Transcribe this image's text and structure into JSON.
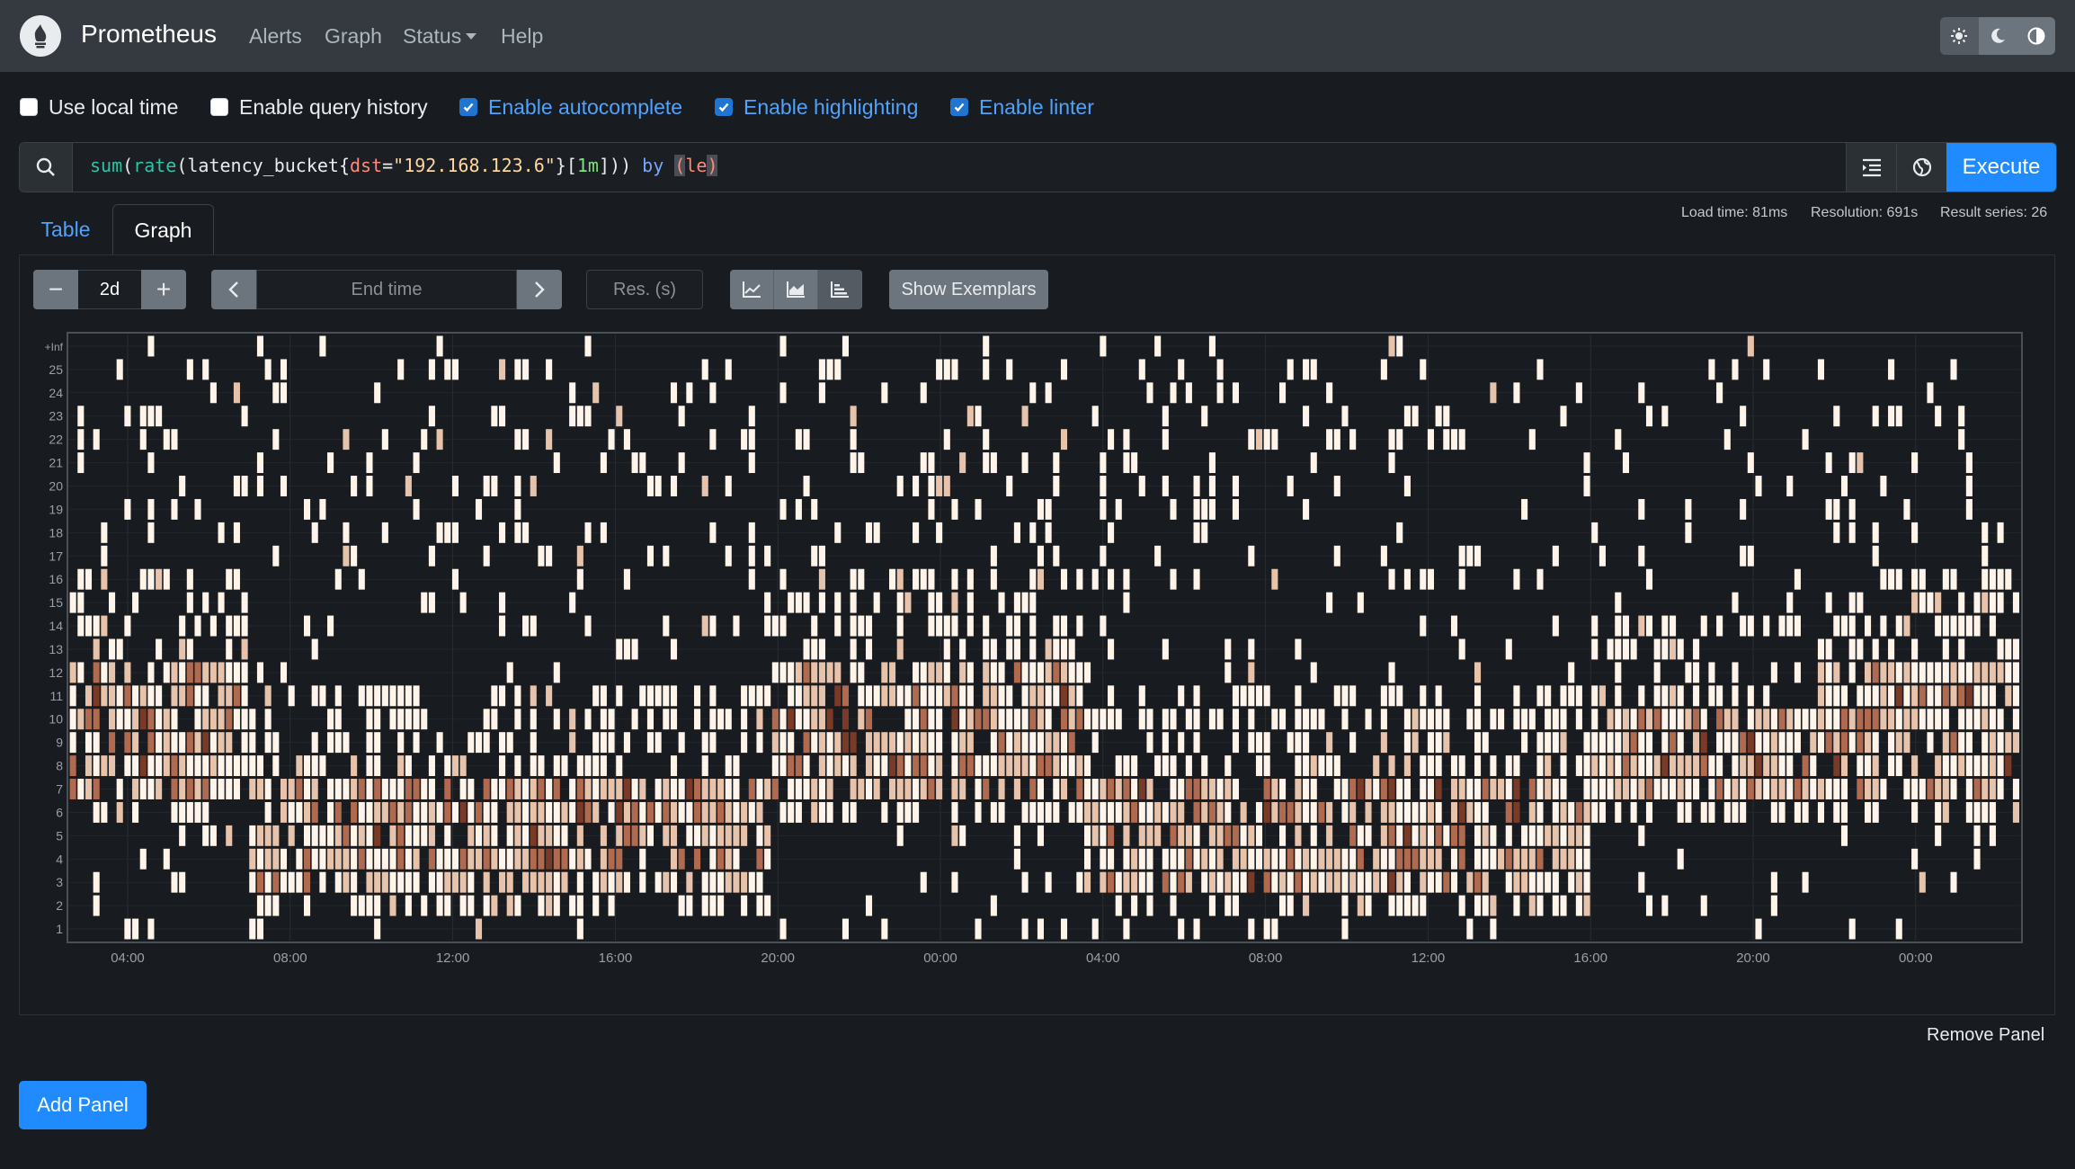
{
  "navbar": {
    "brand": "Prometheus",
    "links": [
      "Alerts",
      "Graph",
      "Status",
      "Help"
    ],
    "theme_buttons": [
      "sun-icon",
      "moon-icon",
      "contrast-icon"
    ]
  },
  "options": [
    {
      "label": "Use local time",
      "checked": false
    },
    {
      "label": "Enable query history",
      "checked": false
    },
    {
      "label": "Enable autocomplete",
      "checked": true
    },
    {
      "label": "Enable highlighting",
      "checked": true
    },
    {
      "label": "Enable linter",
      "checked": true
    }
  ],
  "query": {
    "expression": "sum(rate(latency_bucket{dst=\"192.168.123.6\"}[1m])) by (le)",
    "execute_label": "Execute"
  },
  "tabs": {
    "table": "Table",
    "graph": "Graph"
  },
  "stats": {
    "load_time": "Load time: 81ms",
    "resolution": "Resolution: 691s",
    "result_series": "Result series: 26"
  },
  "controls": {
    "minus": "−",
    "range": "2d",
    "plus": "+",
    "end_time_placeholder": "End time",
    "resolution_placeholder": "Res. (s)",
    "show_exemplars": "Show Exemplars"
  },
  "chart_data": {
    "type": "heatmap",
    "y_labels": [
      "1",
      "2",
      "3",
      "4",
      "5",
      "6",
      "7",
      "8",
      "9",
      "10",
      "11",
      "12",
      "13",
      "14",
      "15",
      "16",
      "17",
      "18",
      "19",
      "20",
      "21",
      "22",
      "23",
      "24",
      "25",
      "+Inf"
    ],
    "x_labels": [
      "04:00",
      "08:00",
      "12:00",
      "16:00",
      "20:00",
      "00:00",
      "04:00",
      "08:00",
      "12:00",
      "16:00",
      "20:00",
      "00:00"
    ],
    "grid": true,
    "color_scale": [
      "#fff4ea",
      "#e8c3ab",
      "#b06a4f",
      "#7a3a28"
    ]
  },
  "footer": {
    "remove_panel": "Remove Panel",
    "add_panel": "Add Panel"
  }
}
